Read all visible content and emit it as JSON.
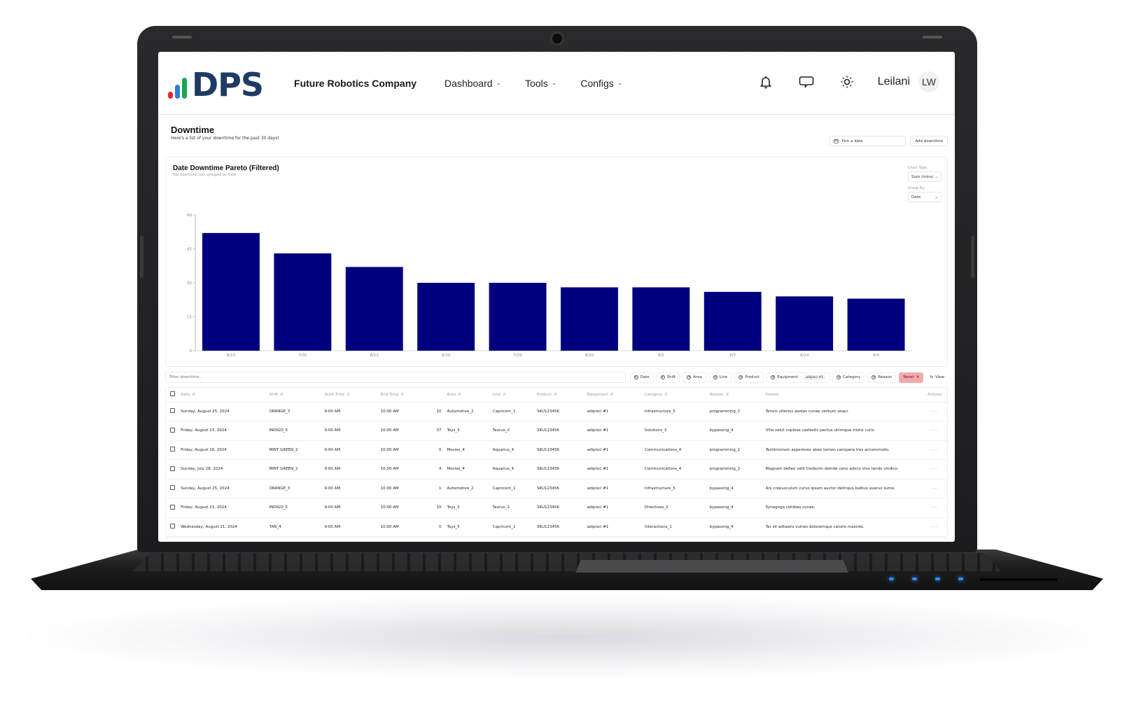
{
  "navbar": {
    "logo_text": "DPS",
    "logo_bar_colors": [
      "#e02a2a",
      "#2f7fd6",
      "#1aa653"
    ],
    "company": "Future Robotics Company",
    "menu": [
      {
        "label": "Dashboard"
      },
      {
        "label": "Tools"
      },
      {
        "label": "Configs"
      }
    ],
    "user_name": "Leilani",
    "avatar_initials": "LW"
  },
  "page": {
    "title": "Downtime",
    "subtitle": "Here's a list of your downtime for the past 30 days!",
    "date_picker_placeholder": "Pick a date",
    "add_button": "Add downtime"
  },
  "chart_card": {
    "title": "Date Downtime Pareto (Filtered)",
    "subtitle": "Top downtime sum grouped by Date",
    "chart_type_label": "Chart Type:",
    "chart_type_value": "Sum (mins)",
    "group_by_label": "Group By:",
    "group_by_value": "Date"
  },
  "chart_data": {
    "type": "bar",
    "title": "Date Downtime Pareto (Filtered)",
    "xlabel": "",
    "ylabel": "",
    "categories": [
      "8/23",
      "7/30",
      "8/13",
      "8/19",
      "7/29",
      "8/20",
      "8/5",
      "8/7",
      "8/14",
      "8/9"
    ],
    "values": [
      52,
      43,
      37,
      30,
      30,
      28,
      28,
      26,
      24,
      23
    ],
    "ylim": [
      0,
      60
    ],
    "yticks": [
      0,
      15,
      30,
      45,
      60
    ],
    "bar_color": "#00007f",
    "grid": false,
    "legend": "none"
  },
  "filters": {
    "search_placeholder": "Filter downtime...",
    "chips": [
      {
        "label": "Date"
      },
      {
        "label": "Shift"
      },
      {
        "label": "Area"
      },
      {
        "label": "Line"
      },
      {
        "label": "Product"
      },
      {
        "label": "Equipment",
        "tag": "adipisci #1"
      },
      {
        "label": "Category"
      },
      {
        "label": "Reason"
      }
    ],
    "reset_label": "Reset",
    "view_label": "View"
  },
  "table": {
    "columns": [
      "Date",
      "Shift",
      "Start Time",
      "End Time",
      "",
      "Area",
      "Line",
      "Product",
      "Equipment",
      "Category",
      "Reason",
      "Details",
      "Actions"
    ],
    "rows": [
      [
        "Sunday, August 25, 2024",
        "ORANGE_3",
        "9:00 AM",
        "10:00 AM",
        "10",
        "Automotive_2",
        "Capricorn_1",
        "SKU123456",
        "adipisci #1",
        "Infrastructure_5",
        "programming_2",
        "Tenuis ulterius aestas cunae verbum sequi."
      ],
      [
        "Friday, August 23, 2024",
        "INDIGO_5",
        "9:00 AM",
        "10:00 AM",
        "37",
        "Toys_3",
        "Taurus_2",
        "SKU123456",
        "adipisci #1",
        "Solutions_3",
        "bypassing_4",
        "Villa velut copiose caelestis pectus utrimque tristis curis."
      ],
      [
        "Friday, August 16, 2024",
        "MINT GREEN_2",
        "9:00 AM",
        "10:00 AM",
        "0",
        "Movies_4",
        "Aquarius_4",
        "SKU123456",
        "adipisci #1",
        "Communications_4",
        "programming_2",
        "Testimonium asperiores abeo tamen campana tres accommodo."
      ],
      [
        "Sunday, July 28, 2024",
        "MINT GREEN_2",
        "9:00 AM",
        "10:00 AM",
        "4",
        "Movies_4",
        "Aquarius_4",
        "SKU123456",
        "adipisci #1",
        "Communications_4",
        "programming_2",
        "Magnam defleo velit tredecim deinde ceno adicio vivo tendo vindico."
      ],
      [
        "Sunday, August 25, 2024",
        "ORANGE_3",
        "9:00 AM",
        "10:00 AM",
        "1",
        "Automotive_2",
        "Capricorn_1",
        "SKU123456",
        "adipisci #1",
        "Infrastructure_5",
        "bypassing_4",
        "Ars crepusculum curvo ipsam auctor delinquo balbus avarus sumo."
      ],
      [
        "Friday, August 23, 2024",
        "INDIGO_5",
        "9:00 AM",
        "10:00 AM",
        "10",
        "Toys_3",
        "Taurus_2",
        "SKU123456",
        "adipisci #1",
        "Directives_2",
        "bypassing_4",
        "Synagoga cohibeo cunae."
      ],
      [
        "Wednesday, August 21, 2024",
        "TAN_4",
        "9:00 AM",
        "10:00 AM",
        "0",
        "Toys_5",
        "Capricorn_1",
        "SKU123456",
        "adipisci #1",
        "Interactions_1",
        "bypassing_4",
        "Tar sit adhaero vulnes doloremque calutio maiores."
      ]
    ],
    "row_action_glyph": "···"
  }
}
